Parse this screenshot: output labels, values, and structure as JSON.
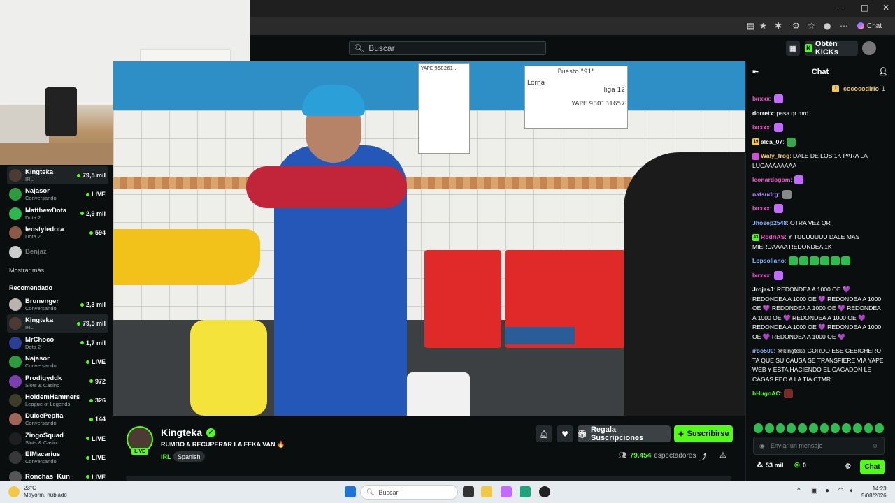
{
  "browser": {
    "chat_pill_label": "Chat",
    "window_controls": [
      "–",
      "□",
      "✕"
    ]
  },
  "header": {
    "search_placeholder": "Buscar",
    "kicks_label": "Obtén KICKs"
  },
  "sidebar": {
    "following": [
      {
        "name": "Kingteka",
        "sub": "IRL",
        "value": "79,5 mil",
        "active": true,
        "color": "#4b3b33"
      },
      {
        "name": "Najasor",
        "sub": "Conversando",
        "value": "LIVE",
        "active": false,
        "color": "#2e9a3e"
      },
      {
        "name": "MatthewDota",
        "sub": "Dota 2",
        "value": "2,9 mil",
        "active": false,
        "color": "#2db84e"
      },
      {
        "name": "leostyledota",
        "sub": "Dota 2",
        "value": "594",
        "active": false,
        "color": "#8a5a46"
      },
      {
        "name": "Benjaz",
        "sub": "",
        "value": "",
        "active": false,
        "color": "#cccccc"
      }
    ],
    "show_more": "Mostrar más",
    "recommended_title": "Recomendado",
    "recommended": [
      {
        "name": "Brunenger",
        "sub": "Conversando",
        "value": "2,3 mil",
        "active": false,
        "color": "#b9b3ad"
      },
      {
        "name": "Kingteka",
        "sub": "IRL",
        "value": "79,5 mil",
        "active": true,
        "color": "#4b3b33"
      },
      {
        "name": "MrChoco",
        "sub": "Dota 2",
        "value": "1,7 mil",
        "active": false,
        "color": "#2b3e96"
      },
      {
        "name": "Najasor",
        "sub": "Conversando",
        "value": "LIVE",
        "active": false,
        "color": "#2e9a3e"
      },
      {
        "name": "Prodigyddk",
        "sub": "Slots & Casino",
        "value": "972",
        "active": false,
        "color": "#7a3fb0"
      },
      {
        "name": "HoldemHammers",
        "sub": "League of Legends",
        "value": "326",
        "active": false,
        "color": "#3d3d2a"
      },
      {
        "name": "DulcePepita",
        "sub": "Conversando",
        "value": "144",
        "active": false,
        "color": "#a1665a"
      },
      {
        "name": "ZingoSquad",
        "sub": "Slots & Casino",
        "value": "LIVE",
        "active": false,
        "color": "#1f1f1f"
      },
      {
        "name": "ElMacarius",
        "sub": "Conversando",
        "value": "LIVE",
        "active": false,
        "color": "#383838"
      },
      {
        "name": "Ronchas_Kun",
        "sub": "",
        "value": "LIVE",
        "active": false,
        "color": "#555555"
      }
    ]
  },
  "video": {
    "sign_top": "YAPE 958261...",
    "sign_price": "Puesto \"91\"",
    "sign_yape": "YAPE 980131657",
    "sign_lorna": "Lorna",
    "sign_liga": "liga 12"
  },
  "channel": {
    "name": "Kingteka",
    "live_label": "LIVE",
    "title": "RUMBO A RECUPERAR LA FEKA VAN 🔥",
    "category": "IRL",
    "tag": "Spanish",
    "gift_label": "Regala Suscripciones",
    "subscribe_label": "Suscribirse",
    "viewers_count": "79.454",
    "viewers_label": "espectadores"
  },
  "chat": {
    "title": "Chat",
    "pinned_user": "cococodirlo",
    "pinned_count": "1",
    "messages": [
      {
        "user": "lxrxxx",
        "text": "",
        "color": "#ff4fd8",
        "emotes": 1,
        "emote_color": "#c46bff"
      },
      {
        "user": "dorretx",
        "text": "pasa qr mrd",
        "color": "#ffffff",
        "emotes": 0,
        "emote_color": ""
      },
      {
        "user": "lxrxxx",
        "text": "",
        "color": "#ff4fd8",
        "emotes": 1,
        "emote_color": "#c46bff"
      },
      {
        "user": "alca_07",
        "text": "",
        "color": "#ffffff",
        "emotes": 1,
        "emote_color": "#3aa84a",
        "badge": "19",
        "badge_color": "#f3c84a"
      },
      {
        "user": "Waly_frog",
        "text": "DALE DE LOS 1K PARA LA LUCAAAAAAAA",
        "color": "#ffd24f",
        "emotes": 0,
        "emote_color": "",
        "badge": "",
        "badge_color": "#d04fd8"
      },
      {
        "user": "leonardogom",
        "text": "",
        "color": "#ff4fd8",
        "emotes": 1,
        "emote_color": "#c46bff"
      },
      {
        "user": "natsudrg",
        "text": "",
        "color": "#b58cff",
        "emotes": 1,
        "emote_color": "#888888"
      },
      {
        "user": "lxrxxx",
        "text": "",
        "color": "#ff4fd8",
        "emotes": 1,
        "emote_color": "#c46bff"
      },
      {
        "user": "Jhosep2548",
        "text": "OTRA VEZ QR",
        "color": "#8ab4ff",
        "emotes": 0,
        "emote_color": ""
      },
      {
        "user": "RodriAS",
        "text": "Y TUUUUUUU DALE MAS MIERDAAAA REDONDEA 1K",
        "color": "#ff4fd8",
        "emotes": 0,
        "emote_color": "",
        "badge": "43",
        "badge_color": "#53fc18"
      },
      {
        "user": "Lopsoliano",
        "text": "",
        "color": "#8ab4ff",
        "emotes": 6,
        "emote_color": "#2dbd4e"
      },
      {
        "user": "lxrxxx",
        "text": "",
        "color": "#ff4fd8",
        "emotes": 1,
        "emote_color": "#c46bff"
      },
      {
        "user": "JrojasJ",
        "text": "REDONDEA A 1000 OE 💜 REDONDEA A 1000 OE 💜 REDONDEA A 1000 OE 💜 REDONDEA A 1000 OE 💜 REDONDEA A 1000 OE 💜 REDONDEA A 1000 OE 💜 REDONDEA A 1000 OE 💜 REDONDEA A 1000 OE 💜 REDONDEA A 1000 OE 💜",
        "color": "#ffffff",
        "emotes": 0,
        "emote_color": ""
      },
      {
        "user": "iroo500",
        "text": "@kingteka GORDO ESE CEBICHERO TA QUE SU CAUSA SE TRANSFIERE VIA YAPE WEB Y ESTA HACIENDO EL CAGADON LE CAGAS FEO A LA TIA CTMR",
        "color": "#8ab4ff",
        "emotes": 0,
        "emote_color": ""
      },
      {
        "user": "hHugoAC",
        "text": "",
        "color": "#53fc18",
        "emotes": 1,
        "emote_color": "#7a2a2a"
      }
    ],
    "input_placeholder": "Enviar un mensaje",
    "kicks_count": "53 mil",
    "points_count": "0",
    "send_label": "Chat"
  },
  "taskbar": {
    "temp": "23°C",
    "weather": "Mayorm. nublado",
    "search_placeholder": "Buscar",
    "time": "14:23",
    "date": "5/08/2026"
  },
  "colors": {
    "accent": "#53fc18",
    "background": "#0b0e0f"
  }
}
